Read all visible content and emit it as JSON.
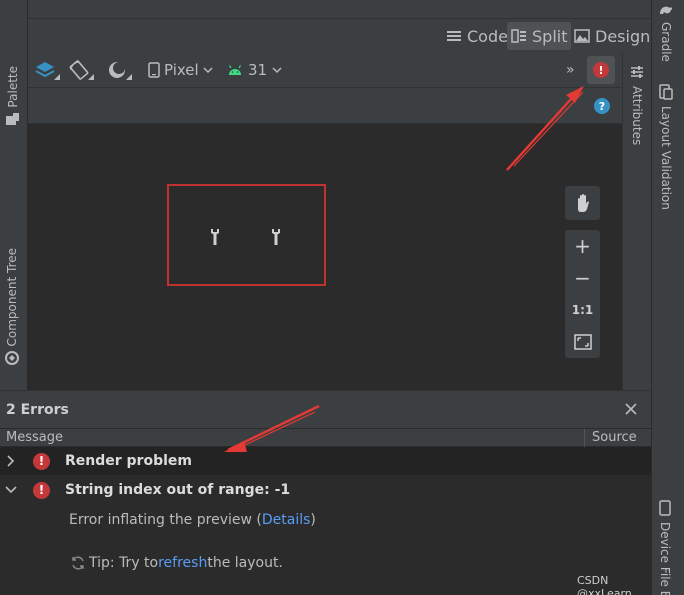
{
  "left_sidebar": {
    "palette_label": "Palette",
    "component_tree_label": "Component Tree"
  },
  "right_sidebar": {
    "gradle_label": "Gradle",
    "layout_validation_label": "Layout Validation",
    "device_file_label": "Device File E"
  },
  "attributes_label": "Attributes",
  "view_modes": {
    "code_label": "Code",
    "split_label": "Split",
    "design_label": "Design",
    "active": "Split"
  },
  "toolbar": {
    "device_label": "Pixel",
    "api_label": "31",
    "overflow_label": "»"
  },
  "zoom": {
    "plus": "+",
    "minus": "−",
    "one_to_one": "1:1"
  },
  "errors_panel": {
    "title": "2 Errors",
    "columns": {
      "message": "Message",
      "source": "Source"
    },
    "rows": [
      {
        "title": "Render problem",
        "expanded": false
      },
      {
        "title": "String index out of range: -1",
        "expanded": true
      }
    ],
    "detail": {
      "prefix": "Error inflating the preview (",
      "link": "Details",
      "suffix": ")"
    },
    "tip": {
      "prefix": "Tip: Try to ",
      "link": "refresh",
      "suffix": " the layout."
    }
  },
  "watermark": "CSDN @xxLearn",
  "colors": {
    "error_red": "#c4383a",
    "link_blue": "#589df6",
    "annotation_red": "#e53935",
    "help_blue": "#3592c4",
    "android_green": "#3ddc84"
  }
}
